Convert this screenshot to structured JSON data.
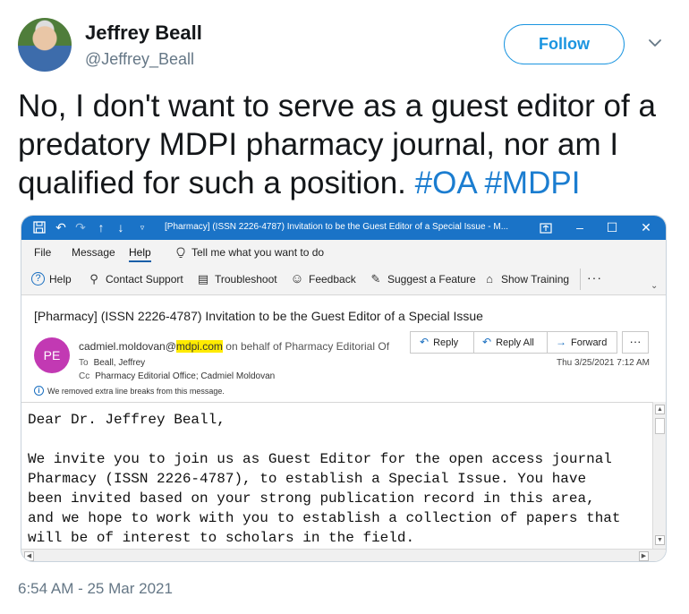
{
  "tweet": {
    "author_name": "Jeffrey Beall",
    "author_handle": "@Jeffrey_Beall",
    "follow_label": "Follow",
    "text_main": "No, I don't want to serve as a guest editor of a predatory MDPI pharmacy journal, nor am I qualified for such a position.",
    "hashtags": [
      "#OA",
      "#MDPI"
    ],
    "timestamp": "6:54 AM - 25 Mar 2021",
    "accent_color": "#1b95e0",
    "hashtag_color": "#1b7dd0"
  },
  "outlook": {
    "window_title": "[Pharmacy] (ISSN 2226-4787) Invitation to be the Guest Editor of a Special Issue  -  M...",
    "titlebar_color": "#1a73c7",
    "menu": [
      "File",
      "Message",
      "Help"
    ],
    "active_menu": "Help",
    "tell_me": "Tell me what you want to do",
    "ribbon": [
      {
        "label": "Help",
        "icon": "question-circle-icon"
      },
      {
        "label": "Contact Support",
        "icon": "person-support-icon"
      },
      {
        "label": "Troubleshoot",
        "icon": "troubleshoot-icon"
      },
      {
        "label": "Feedback",
        "icon": "smiley-icon"
      },
      {
        "label": "Suggest a Feature",
        "icon": "suggest-feature-icon"
      },
      {
        "label": "Show Training",
        "icon": "training-cap-icon"
      }
    ],
    "ribbon_more": "···",
    "subject": "[Pharmacy] (ISSN 2226-4787) Invitation to be the Guest Editor of a Special Issue",
    "sender_initials": "PE",
    "sender_avatar_color": "#c239b3",
    "sender_prefix": "cadmiel.moldovan@",
    "sender_domain": "mdpi.com",
    "sender_suffix": "on behalf of Pharmacy Editorial Of",
    "to_label": "To",
    "to_value": "Beall, Jeffrey",
    "cc_label": "Cc",
    "cc_value": "Pharmacy Editorial Office; Cadmiel Moldovan",
    "actions": [
      "Reply",
      "Reply All",
      "Forward"
    ],
    "more_label": "···",
    "date": "Thu 3/25/2021 7:12 AM",
    "info_text": "We removed extra line breaks from this message.",
    "body_lines": [
      "Dear Dr. Jeffrey Beall,",
      "",
      "We invite you to join us as Guest Editor for the open access journal",
      "Pharmacy (ISSN 2226-4787), to establish a Special Issue. You have",
      "been invited based on your strong publication record in this area,",
      "and we hope to work with you to establish a collection of papers that",
      "will be of interest to scholars in the field."
    ]
  }
}
